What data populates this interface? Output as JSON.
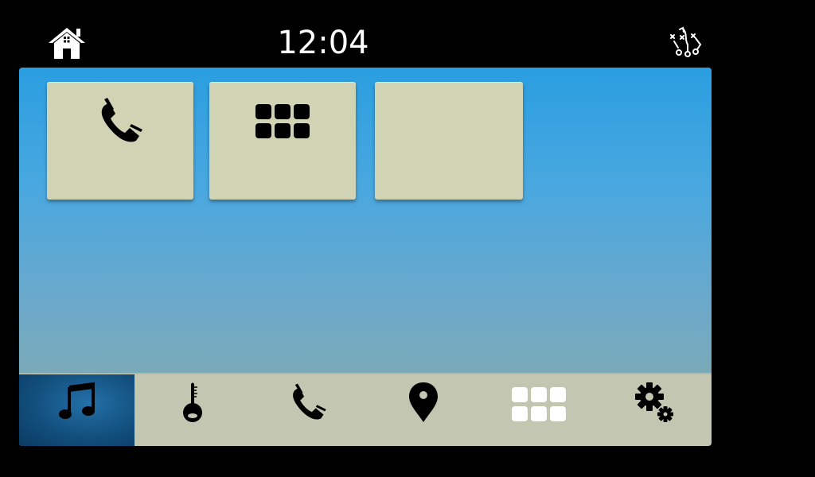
{
  "header": {
    "clock": "12:04",
    "home_icon": "home-icon",
    "playbook_icon": "playbook-icon"
  },
  "tiles": [
    {
      "icon": "phone-icon"
    },
    {
      "icon": "app-grid-icon"
    },
    {
      "icon": ""
    }
  ],
  "dock": {
    "items": [
      {
        "icon": "music-icon",
        "active": true
      },
      {
        "icon": "thermometer-icon",
        "active": false
      },
      {
        "icon": "phone-icon",
        "active": false
      },
      {
        "icon": "location-pin-icon",
        "active": false
      },
      {
        "icon": "app-grid-icon",
        "active": false
      },
      {
        "icon": "settings-gears-icon",
        "active": false
      }
    ]
  },
  "colors": {
    "background": "#000000",
    "panel_top": "#2a9ee0",
    "panel_bottom": "#7aaab8",
    "tile": "#d1d3b5",
    "dock": "#c3c6b1",
    "dock_active": "#12507e",
    "clock_text": "#ffffff"
  }
}
